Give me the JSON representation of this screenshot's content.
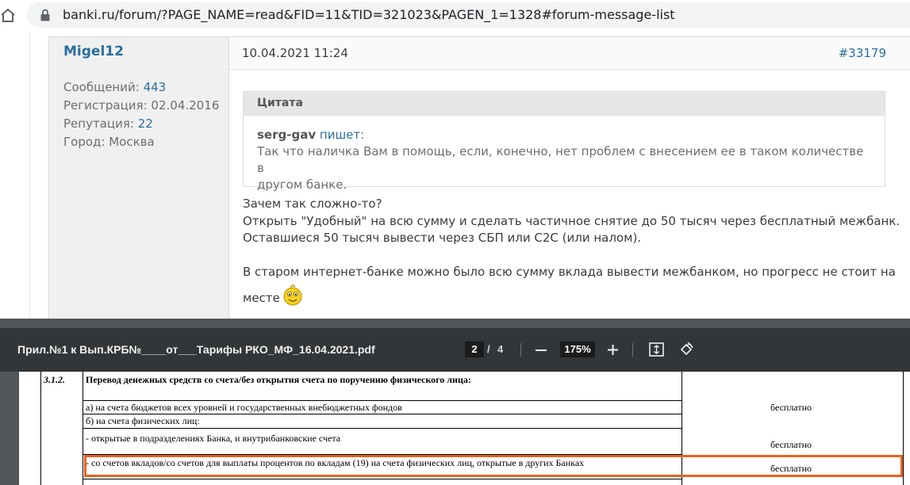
{
  "browser": {
    "url": "banki.ru/forum/?PAGE_NAME=read&FID=11&TID=321023&PAGEN_1=1328#forum-message-list"
  },
  "post": {
    "author": {
      "name": "Migel12",
      "messages_label": "Сообщений:",
      "messages": "443",
      "registration_label": "Регистрация:",
      "registration": "02.04.2016",
      "reputation_label": "Репутация:",
      "reputation": "22",
      "city_label": "Город:",
      "city": "Москва"
    },
    "date": "10.04.2021 11:24",
    "number": "#33179",
    "quote": {
      "header": "Цитата",
      "author": "serg-gav",
      "writes": "пишет",
      "colon": ":",
      "line1": "Так что наличка Вам в помощь, если, конечно, нет проблем с внесением ее в таком количестве в",
      "line2": "другом банке."
    },
    "body": {
      "line1": "Зачем так сложно-то?",
      "line2": "Открыть \"Удобный\" на всю сумму и сделать частичное снятие до 50 тысяч через бесплатный межбанк.",
      "line3": "Оставшиеся 50 тысяч вывести через СБП или C2C (или налом).",
      "line4": "В старом интернет-банке можно было всю сумму вклада вывести межбанком, но прогресс не стоит на",
      "line5": "месте"
    }
  },
  "pdf": {
    "title": "Прил.№1 к Вып.КРБ№____от___Тарифы РКО_МФ_16.04.2021.pdf",
    "page_current": "2",
    "page_separator": "/",
    "page_total": "4",
    "zoom": "175%",
    "table": {
      "row_num": "3.1.2.",
      "heading": "Перевод денежных средств со счета/без открытия счета по поручению физического лица:",
      "rows": [
        {
          "text": "а) на счета бюджетов всех уровней и государственных внебюджетных фондов",
          "fee": "бесплатно"
        },
        {
          "text": "б) на счета физических лиц:",
          "fee": ""
        },
        {
          "text": "- открытые в подразделениях Банка, и внутрибанковские счета",
          "fee": "бесплатно"
        },
        {
          "text": "- со счетов вкладов/со счетов для выплаты процентов по вкладам (19) на счета физических лиц, открытые в других Банках",
          "fee": "бесплатно"
        }
      ]
    }
  },
  "colors": {
    "link": "#2a6f9d",
    "highlight": "#e8621d",
    "pdf_toolbar": "#323639"
  }
}
